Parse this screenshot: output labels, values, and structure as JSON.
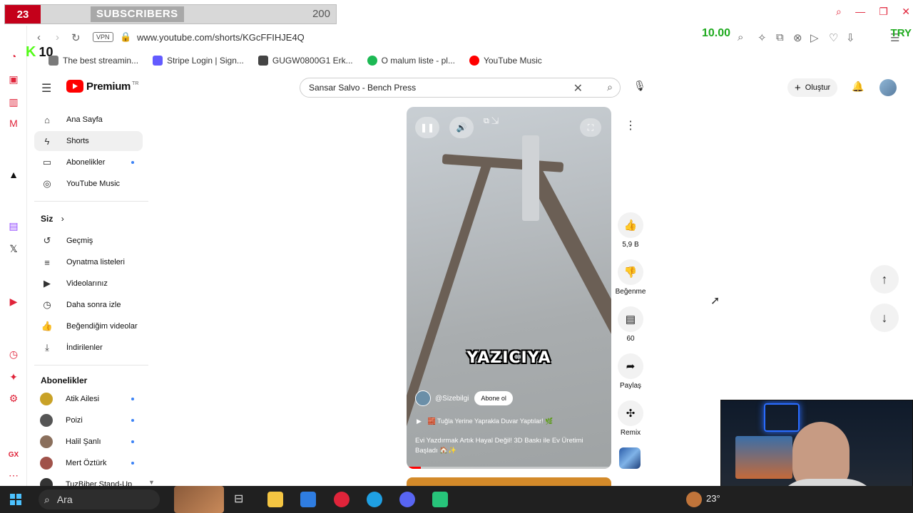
{
  "overlay": {
    "sub_count": "23",
    "sub_label": "SUBSCRIBERS",
    "sub_goal": "200",
    "k_count": "10",
    "green_value": "10.00",
    "try_label": "TRY"
  },
  "browser": {
    "vpn": "VPN",
    "url": "www.youtube.com/shorts/KGcFFIHJE4Q",
    "bookmarks": [
      {
        "label": "The best streamin...",
        "color": "#7a7a7a"
      },
      {
        "label": "Stripe Login | Sign...",
        "color": "#635bff"
      },
      {
        "label": "GUGW0800G1 Erk...",
        "color": "#444444"
      },
      {
        "label": "O malum liste - pl...",
        "color": "#1db954"
      },
      {
        "label": "YouTube Music",
        "color": "#ff0000"
      }
    ]
  },
  "header": {
    "logo": "Premium",
    "logo_region": "TR",
    "search_value": "Sansar Salvo - Bench Press",
    "create_label": "Oluştur"
  },
  "sidebar": {
    "main": [
      {
        "label": "Ana Sayfa",
        "icon": "home-icon"
      },
      {
        "label": "Shorts",
        "icon": "shorts-icon"
      },
      {
        "label": "Abonelikler",
        "icon": "subscriptions-icon"
      },
      {
        "label": "YouTube Music",
        "icon": "youtube-music-icon"
      }
    ],
    "you_heading": "Siz",
    "you": [
      {
        "label": "Geçmiş",
        "icon": "history-icon"
      },
      {
        "label": "Oynatma listeleri",
        "icon": "playlists-icon"
      },
      {
        "label": "Videolarınız",
        "icon": "your-videos-icon"
      },
      {
        "label": "Daha sonra izle",
        "icon": "watch-later-icon"
      },
      {
        "label": "Beğendiğim videolar",
        "icon": "liked-videos-icon"
      },
      {
        "label": "İndirilenler",
        "icon": "downloads-icon"
      }
    ],
    "subs_heading": "Abonelikler",
    "subs": [
      {
        "label": "Atik Ailesi",
        "color": "#c9a227"
      },
      {
        "label": "Poizi",
        "color": "#555555"
      },
      {
        "label": "Halil Şanlı",
        "color": "#8a6f5c"
      },
      {
        "label": "Mert Öztürk",
        "color": "#a0524a"
      },
      {
        "label": "TuzBiber Stand-Up",
        "color": "#333333"
      }
    ]
  },
  "short": {
    "caption": "YAZICIYA",
    "channel": "@Sizebilgi",
    "subscribe": "Abone ol",
    "title_line": "🧱 Tuğla Yerine Yaprakla Duvar Yaptılar! 🌿",
    "description": "Evi Yazdırmak Artık Hayal Değil! 3D Baskı ile Ev Üretimi Başladı 🏠✨",
    "progress": 0.07
  },
  "actions": {
    "likes": "5,9 B",
    "dislike": "Beğenme",
    "comments": "60",
    "share": "Paylaş",
    "remix": "Remix"
  },
  "taskbar": {
    "search": "Ara",
    "temp": "23°"
  }
}
